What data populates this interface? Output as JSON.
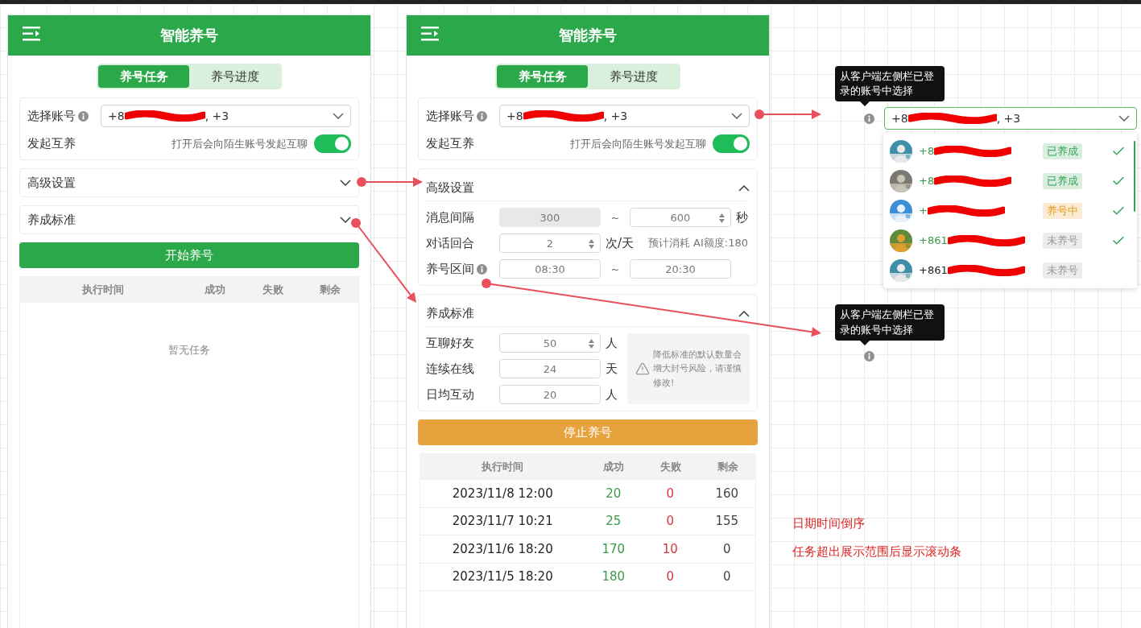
{
  "panels": [
    {
      "title": "智能养号",
      "tabs": [
        {
          "label": "养号任务",
          "selected": true
        },
        {
          "label": "养号进度",
          "selected": false
        }
      ],
      "account": {
        "label": "选择账号",
        "value_start": "+8",
        "value_end": ", +3"
      },
      "mutual": {
        "label": "发起互养",
        "hint": "打开后会向陌生账号发起互聊",
        "on": true
      },
      "sections": [
        {
          "title": "高级设置",
          "expanded": false
        },
        {
          "title": "养成标准",
          "expanded": false
        }
      ],
      "action": {
        "label": "开始养号",
        "kind": "start"
      },
      "table": {
        "columns": [
          "执行时间",
          "成功",
          "失败",
          "剩余"
        ],
        "empty_text": "暂无任务"
      }
    },
    {
      "title": "智能养号",
      "tabs": [
        {
          "label": "养号任务",
          "selected": true
        },
        {
          "label": "养号进度",
          "selected": false
        }
      ],
      "account": {
        "label": "选择账号",
        "value_start": "+8",
        "value_end": ", +3"
      },
      "mutual": {
        "label": "发起互养",
        "hint": "打开后会向陌生账号发起互聊",
        "on": true
      },
      "sections": [
        {
          "title": "高级设置",
          "expanded": true,
          "rows": [
            {
              "label": "消息间隔",
              "inputs": [
                {
                  "value": "300",
                  "disabled": true
                },
                {
                  "value": "600",
                  "disabled": false,
                  "spinner": true
                }
              ],
              "separator": "~",
              "unit": "秒"
            },
            {
              "label": "对话回合",
              "inputs": [
                {
                  "value": "2",
                  "disabled": false,
                  "spinner": true
                }
              ],
              "unit": "次/天",
              "note": "预计消耗 AI额度:180"
            },
            {
              "label": "养号区间",
              "info": true,
              "inputs": [
                {
                  "value": "08:30",
                  "disabled": false
                },
                {
                  "value": "20:30",
                  "disabled": false
                }
              ],
              "separator": "~"
            }
          ]
        },
        {
          "title": "养成标准",
          "expanded": true,
          "rows": [
            {
              "label": "互聊好友",
              "inputs": [
                {
                  "value": "50",
                  "disabled": false,
                  "spinner": true
                }
              ],
              "unit": "人"
            },
            {
              "label": "连续在线",
              "inputs": [
                {
                  "value": "24",
                  "disabled": false
                }
              ],
              "unit": "天"
            },
            {
              "label": "日均互动",
              "inputs": [
                {
                  "value": "20",
                  "disabled": false
                }
              ],
              "unit": "人"
            }
          ],
          "warning": "降低标准的默认数量会增大封号风险，请谨慎修改!"
        }
      ],
      "action": {
        "label": "停止养号",
        "kind": "stop"
      },
      "table": {
        "columns": [
          "执行时间",
          "成功",
          "失败",
          "剩余"
        ],
        "rows": [
          [
            "2023/11/8 12:00",
            "20",
            "0",
            "160"
          ],
          [
            "2023/11/7 10:21",
            "25",
            "0",
            "155"
          ],
          [
            "2023/11/6 18:20",
            "170",
            "10",
            "0"
          ],
          [
            "2023/11/5 18:20",
            "180",
            "0",
            "0"
          ]
        ]
      }
    }
  ],
  "picker": {
    "tooltip": "从客户端左侧栏已登录的账号中选择",
    "value_start": "+8",
    "value_end": ", +3",
    "options": [
      {
        "number": "+8",
        "status": "已养成",
        "color": "#3aa35a",
        "selected": true
      },
      {
        "number": "+8",
        "status": "已养成",
        "color": "#3aa35a",
        "selected": true
      },
      {
        "number": "+",
        "status": "养号中",
        "color": "#e69a1c",
        "selected": true
      },
      {
        "number": "+861",
        "status": "未养号",
        "color": "#999999",
        "selected": true
      },
      {
        "number": "+861",
        "status": "未养号",
        "color": "#999999",
        "selected": false
      }
    ]
  },
  "info_tooltip": {
    "text": "从客户端左侧栏已登录的账号中选择"
  },
  "notes": [
    "日期时间倒序",
    "任务超出展示范围后显示滚动条"
  ]
}
